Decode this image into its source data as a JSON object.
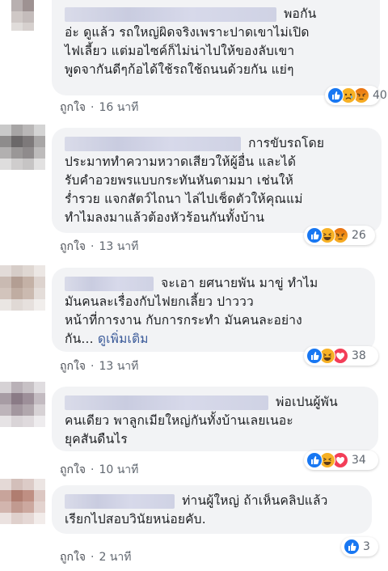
{
  "comments": [
    {
      "text_head": "พอกัน",
      "text": "อ่ะ ดูแล้ว รถใหญ่ผิดจริงเพราะปาดเขาไม่เปิด\nไฟเลี้ยว แต่มอไซค์ก็ไม่น่าไปให้ของลับเขา\nพูดจากันดีๆก้อได้ใช้รถใช้ถนนด้วยกัน แย่ๆ",
      "like": "ถูกใจ",
      "time": "16 นาที",
      "reactions": [
        "like",
        "sad",
        "angry"
      ],
      "count": "40"
    },
    {
      "text_head": "การขับรถโดย",
      "text": "ประมาททำความหวาดเสียวให้ผู้อื่น และได้\nรับคำอวยพรแบบกระทันหันตามมา เช่นให้\nร่ำรวย แจกสัตว์ไถนา ไล่ไปเช็ดตัวให้คุณแม่\nทำไมลงมาแล้วต้องหัวร้อนกันทั้งบ้าน",
      "like": "ถูกใจ",
      "time": "13 นาที",
      "reactions": [
        "like",
        "haha",
        "angry"
      ],
      "count": "26"
    },
    {
      "text_head": "จะเอา ยศนายพัน มาขู่ ทำไม",
      "text": "มันคนละเรื่องกับไฟยกเลี้ยว ปาววว\nหน้าที่การงาน กับการกระทำ มันคนละอย่าง\nกัน...",
      "more": "ดูเพิ่มเติม",
      "like": "ถูกใจ",
      "time": "13 นาที",
      "reactions": [
        "like",
        "haha",
        "love"
      ],
      "count": "38"
    },
    {
      "text_head": "พ่อเปนผู้พัน",
      "text": "คนเดียว พาลูกเมียใหญ่กันทั้งบ้านเลยเนอะ\nยุคสันดืนไร",
      "like": "ถูกใจ",
      "time": "10 นาที",
      "reactions": [
        "like",
        "haha",
        "love"
      ],
      "count": "34"
    },
    {
      "text_head": "ท่านผู้ใหญ่ ถ้าเห็นคลิปแล้ว",
      "text": "เรียกไปสอบวินัยหน่อยคับ.",
      "like": "ถูกใจ",
      "time": "2 นาที",
      "reactions": [
        "like"
      ],
      "count": "3"
    }
  ],
  "separator": "·",
  "colors": {
    "bubble": "#f2f3f5",
    "link": "#385898",
    "like_blue": "#1877f2",
    "haha_yellow": "#f7b125",
    "love_red": "#f33e58"
  }
}
